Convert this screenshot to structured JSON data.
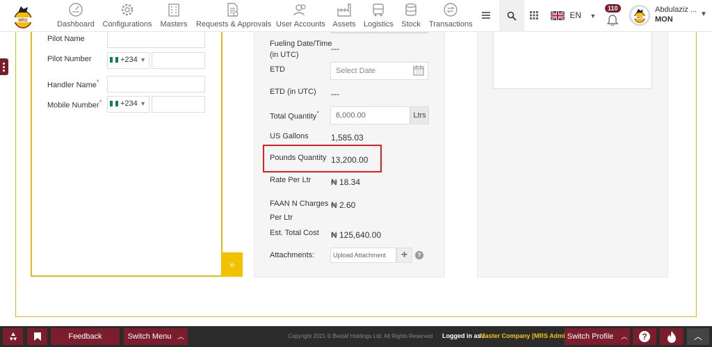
{
  "nav": {
    "items": [
      {
        "label": "Dashboard",
        "icon": "dashboard-icon"
      },
      {
        "label": "Configurations",
        "icon": "gear-icon"
      },
      {
        "label": "Masters",
        "icon": "building-icon"
      },
      {
        "label": "Requests & Approvals",
        "icon": "document-icon"
      },
      {
        "label": "User Accounts",
        "icon": "users-icon"
      },
      {
        "label": "Assets",
        "icon": "factory-icon"
      },
      {
        "label": "Logistics",
        "icon": "truck-icon"
      },
      {
        "label": "Stock",
        "icon": "stack-icon"
      },
      {
        "label": "Transactions",
        "icon": "exchange-icon"
      }
    ],
    "lang": "EN",
    "notification_count": "110",
    "user_name": "Abdulaziz ...",
    "user_sub": "MON"
  },
  "left_form": {
    "pilot_name_label": "Pilot Name",
    "pilot_number_label": "Pilot Number",
    "handler_name_label": "Handler Name",
    "mobile_number_label": "Mobile Number",
    "country_code": "+234",
    "required_mark": "*"
  },
  "mid_form": {
    "fueling_label_1": "Fueling Date/Time",
    "fueling_label_2": "(in UTC)",
    "fueling_value": "---",
    "etd_label": "ETD",
    "etd_placeholder": "Select Date",
    "etd_utc_label": "ETD (in UTC)",
    "etd_utc_value": "---",
    "total_qty_label": "Total Quantity",
    "total_qty_value": "6,000.00",
    "total_qty_unit": "Ltrs",
    "us_gallons_label": "US Gallons",
    "us_gallons_value": "1,585.03",
    "pounds_label": "Pounds Quantity",
    "pounds_value": "13,200.00",
    "rate_label": "Rate Per Ltr",
    "rate_value": "₦ 18.34",
    "faan_label_1": "FAAN N Charges",
    "faan_label_2": "Per Ltr",
    "faan_value": "₦ 2.60",
    "est_cost_label": "Est. Total Cost",
    "est_cost_value": "₦ 125,640.00",
    "attachments_label": "Attachments:",
    "upload_placeholder": "Upload Attachment"
  },
  "footer": {
    "feedback": "Feedback",
    "switch_menu": "Switch Menu",
    "copyright": "Copyright 2021 © Bestaf Holdings Ltd. All Rights Reserved",
    "logged_in_as": "Logged in as :",
    "company": "Master Company [MRS Admin]",
    "switch_profile": "Switch Profile"
  },
  "colors": {
    "brand": "#7c1d2e",
    "accent": "#f2c200",
    "highlight": "#e02020"
  }
}
